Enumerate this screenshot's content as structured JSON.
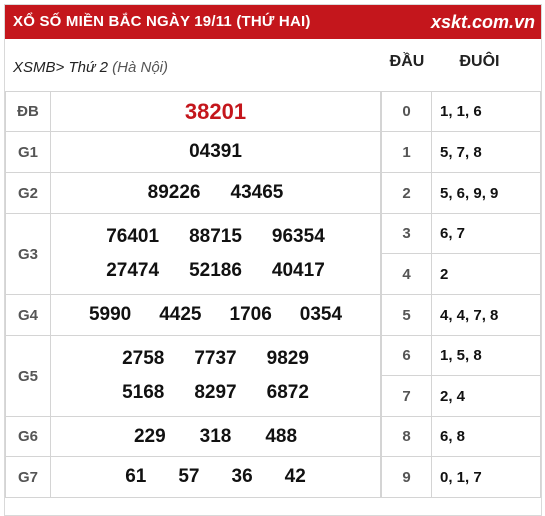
{
  "header": {
    "title": "XỔ SỐ MIỀN BẮC NGÀY 19/11 (THỨ HAI)",
    "logo": "xskt.com.vn"
  },
  "subheader": {
    "region": "XSMB",
    "separator": ">",
    "day": "Thứ 2",
    "province": "(Hà Nội)",
    "dau_label": "ĐẦU",
    "duoi_label": "ĐUÔI"
  },
  "results": {
    "db": {
      "label": "ĐB",
      "numbers": [
        "38201"
      ]
    },
    "g1": {
      "label": "G1",
      "numbers": [
        "04391"
      ]
    },
    "g2": {
      "label": "G2",
      "numbers": [
        "89226",
        "43465"
      ]
    },
    "g3": {
      "label": "G3",
      "row1": [
        "76401",
        "88715",
        "96354"
      ],
      "row2": [
        "27474",
        "52186",
        "40417"
      ]
    },
    "g4": {
      "label": "G4",
      "numbers": [
        "5990",
        "4425",
        "1706",
        "0354"
      ]
    },
    "g5": {
      "label": "G5",
      "row1": [
        "2758",
        "7737",
        "9829"
      ],
      "row2": [
        "5168",
        "8297",
        "6872"
      ]
    },
    "g6": {
      "label": "G6",
      "numbers": [
        "229",
        "318",
        "488"
      ]
    },
    "g7": {
      "label": "G7",
      "numbers": [
        "61",
        "57",
        "36",
        "42"
      ]
    }
  },
  "loto": [
    {
      "head": "0",
      "tail": "1, 1, 6"
    },
    {
      "head": "1",
      "tail": "5, 7, 8"
    },
    {
      "head": "2",
      "tail": "5, 6, 9, 9"
    },
    {
      "head": "3",
      "tail": "6, 7"
    },
    {
      "head": "4",
      "tail": "2"
    },
    {
      "head": "5",
      "tail": "4, 4, 7, 8"
    },
    {
      "head": "6",
      "tail": "1, 5, 8"
    },
    {
      "head": "7",
      "tail": "2, 4"
    },
    {
      "head": "8",
      "tail": "6, 8"
    },
    {
      "head": "9",
      "tail": "0, 1, 7"
    }
  ],
  "colors": {
    "brand_red": "#c4161c",
    "border": "#d4d4d4",
    "label_gray": "#555555"
  }
}
